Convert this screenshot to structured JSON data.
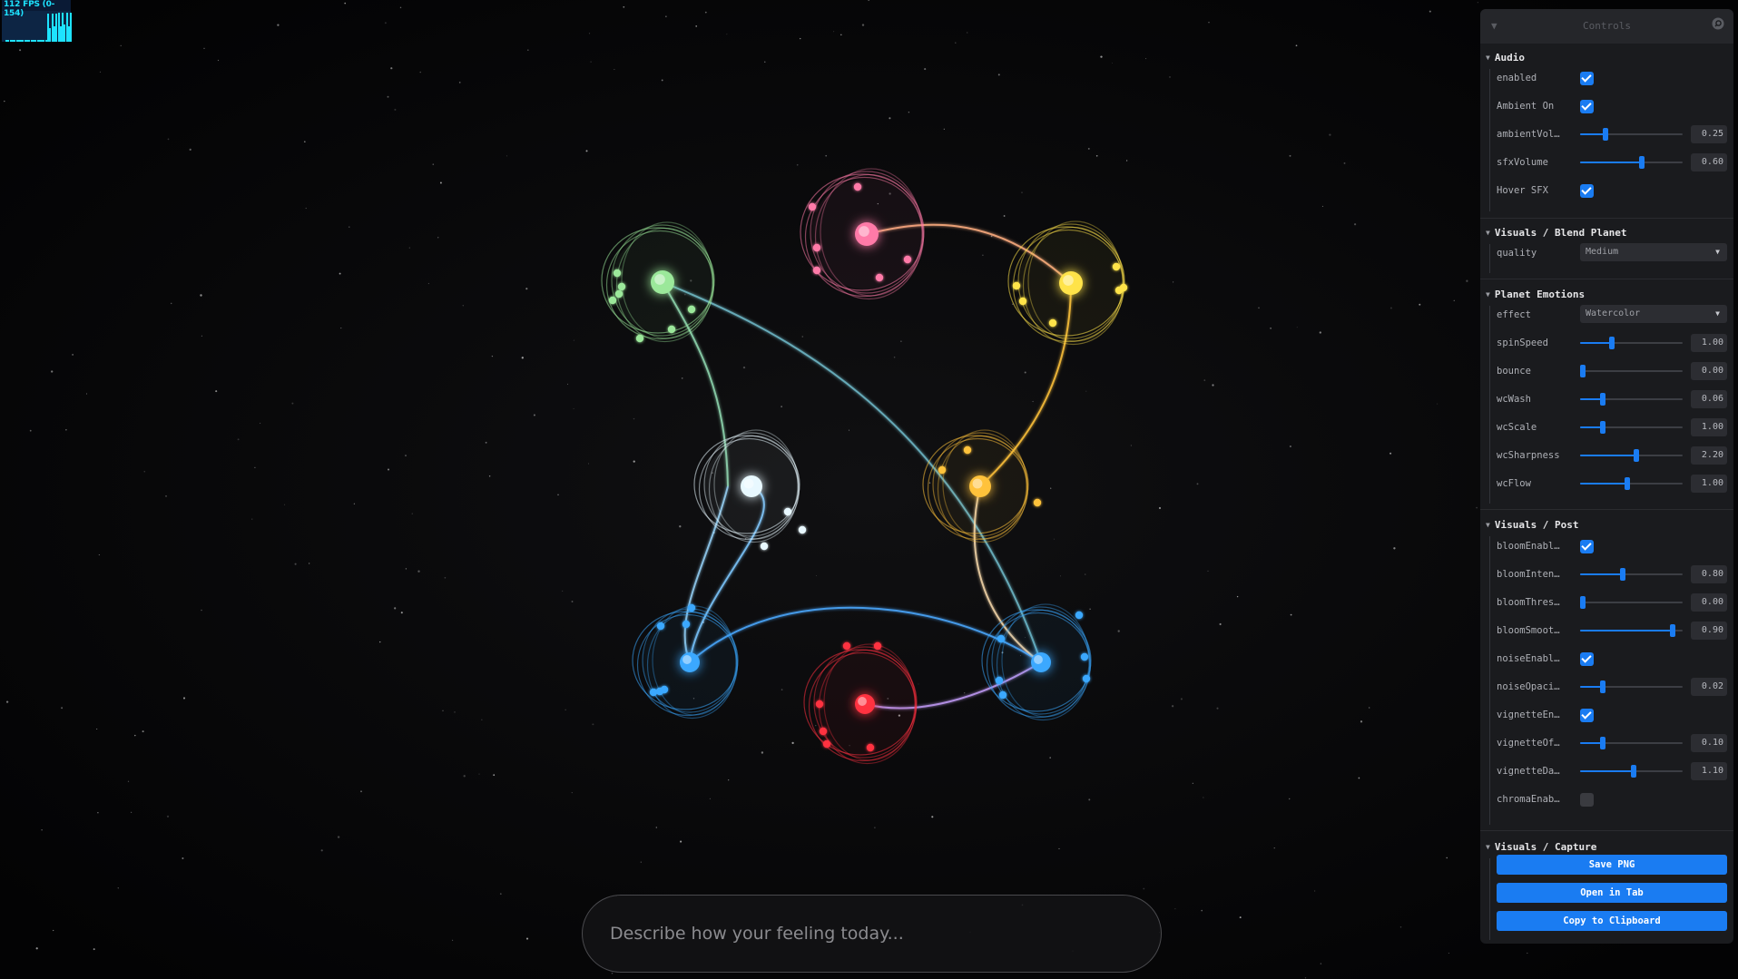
{
  "fps": {
    "label": "112 FPS (0-154)",
    "history": [
      0.06,
      0.06,
      0.07,
      0.06,
      0.06,
      0.07,
      0.06,
      0.06,
      0.07,
      0.06,
      0.06,
      0.07,
      0.06,
      0.06,
      0.07,
      0.06,
      0.06,
      0.07,
      0.06,
      0.06,
      0.9,
      0.45,
      0.9,
      0.5,
      0.9,
      0.95,
      0.5,
      0.95,
      0.55,
      0.95,
      0.5,
      0.95
    ]
  },
  "prompt": {
    "placeholder": "Describe how your feeling today..."
  },
  "colors": {
    "green": "#9be89a",
    "pink": "#ff7aa8",
    "yellow": "#ffe34a",
    "white": "#e8f8ff",
    "orange": "#ffc23a",
    "blue": "#3aa8ff",
    "red": "#ff3040",
    "accent": "#1a7cf2"
  },
  "controls": {
    "title": "Controls",
    "collapse_icon": "chevron-down-icon",
    "search_icon": "search-icon",
    "audio": {
      "title": "Audio",
      "enabled": {
        "label": "enabled",
        "checked": true
      },
      "ambient_on": {
        "label": "Ambient On",
        "checked": true
      },
      "ambient_volume": {
        "label": "ambientVol…",
        "value": "0.25",
        "fraction": 0.25
      },
      "sfx_volume": {
        "label": "sfxVolume",
        "value": "0.60",
        "fraction": 0.6
      },
      "hover_sfx": {
        "label": "Hover SFX",
        "checked": true
      }
    },
    "blend_planet": {
      "title": "Visuals / Blend Planet",
      "quality": {
        "label": "quality",
        "value": "Medium"
      }
    },
    "planet_emotions": {
      "title": "Planet Emotions",
      "effect": {
        "label": "effect",
        "value": "Watercolor"
      },
      "spin_speed": {
        "label": "spinSpeed",
        "value": "1.00",
        "fraction": 0.31
      },
      "bounce": {
        "label": "bounce",
        "value": "0.00",
        "fraction": 0.0
      },
      "wc_wash": {
        "label": "wcWash",
        "value": "0.06",
        "fraction": 0.22
      },
      "wc_scale": {
        "label": "wcScale",
        "value": "1.00",
        "fraction": 0.22
      },
      "wc_sharpness": {
        "label": "wcSharpness",
        "value": "2.20",
        "fraction": 0.55
      },
      "wc_flow": {
        "label": "wcFlow",
        "value": "1.00",
        "fraction": 0.46
      }
    },
    "post": {
      "title": "Visuals / Post",
      "bloom_enabled": {
        "label": "bloomEnabl…",
        "checked": true
      },
      "bloom_intensity": {
        "label": "bloomInten…",
        "value": "0.80",
        "fraction": 0.42
      },
      "bloom_threshold": {
        "label": "bloomThres…",
        "value": "0.00",
        "fraction": 0.0
      },
      "bloom_smoothing": {
        "label": "bloomSmoot…",
        "value": "0.90",
        "fraction": 0.9
      },
      "noise_enabled": {
        "label": "noiseEnabl…",
        "checked": true
      },
      "noise_opacity": {
        "label": "noiseOpaci…",
        "value": "0.02",
        "fraction": 0.22
      },
      "vignette_enabled": {
        "label": "vignetteEn…",
        "checked": true
      },
      "vignette_offset": {
        "label": "vignetteOf…",
        "value": "0.10",
        "fraction": 0.22
      },
      "vignette_darkness": {
        "label": "vignetteDa…",
        "value": "1.10",
        "fraction": 0.52
      },
      "chroma_enabled": {
        "label": "chromaEnab…",
        "checked": false
      }
    },
    "capture": {
      "title": "Visuals / Capture",
      "save_png": "Save PNG",
      "open_in_tab": "Open in Tab",
      "copy_to_clipboard": "Copy to Clipboard"
    }
  }
}
